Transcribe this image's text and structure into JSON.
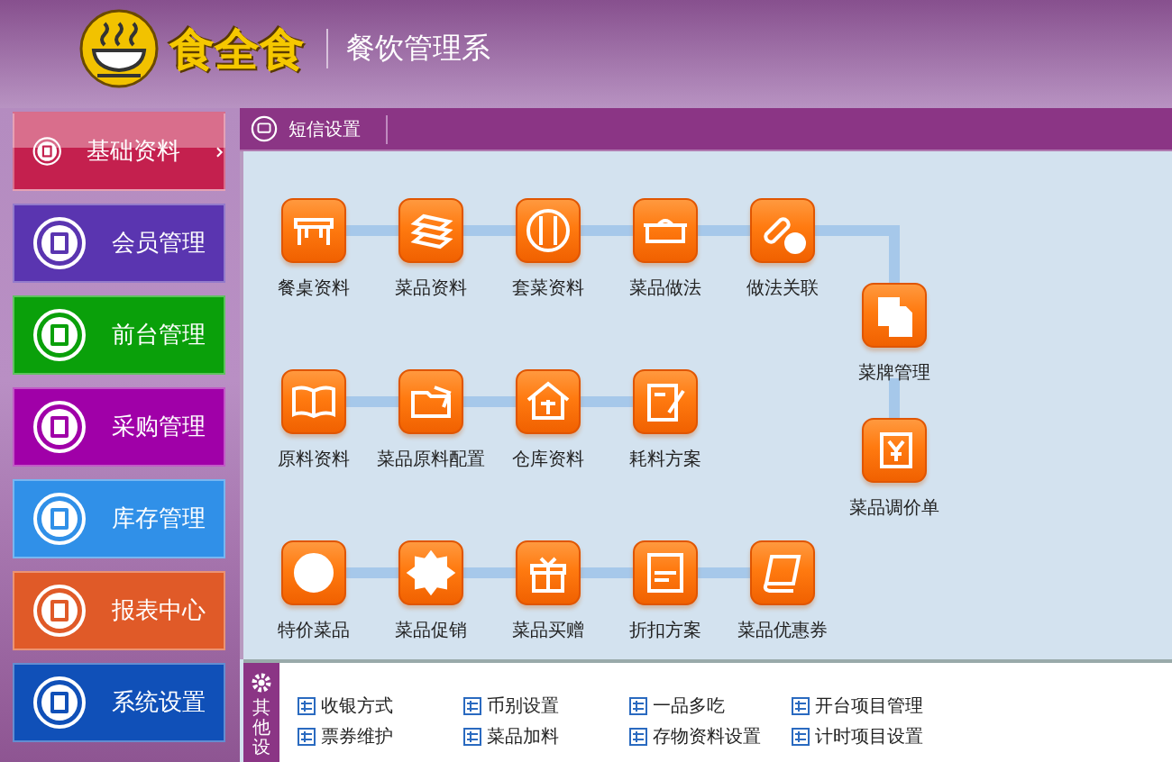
{
  "header": {
    "brand": "食全食",
    "system_title": "餐饮管理系"
  },
  "sidebar": {
    "items": [
      {
        "label": "基础资料",
        "selected": true,
        "color": "#c4204e"
      },
      {
        "label": "会员管理",
        "selected": false,
        "color": "#5a35b0"
      },
      {
        "label": "前台管理",
        "selected": false,
        "color": "#0aa00a"
      },
      {
        "label": "采购管理",
        "selected": false,
        "color": "#a000a8"
      },
      {
        "label": "库存管理",
        "selected": false,
        "color": "#3090e8"
      },
      {
        "label": "报表中心",
        "selected": false,
        "color": "#e05a28"
      },
      {
        "label": "系统设置",
        "selected": false,
        "color": "#1050b8"
      }
    ]
  },
  "tab": {
    "label": "短信设置"
  },
  "modules": [
    {
      "label": "餐桌资料"
    },
    {
      "label": "菜品资料"
    },
    {
      "label": "套菜资料"
    },
    {
      "label": "菜品做法"
    },
    {
      "label": "做法关联"
    },
    {
      "label": "菜牌管理"
    },
    {
      "label": "菜品调价单"
    },
    {
      "label": "原料资料"
    },
    {
      "label": "菜品原料配置"
    },
    {
      "label": "仓库资料"
    },
    {
      "label": "耗料方案"
    },
    {
      "label": "特价菜品"
    },
    {
      "label": "菜品促销"
    },
    {
      "label": "菜品买赠"
    },
    {
      "label": "折扣方案"
    },
    {
      "label": "菜品优惠券"
    }
  ],
  "other_settings": {
    "title": "其他设",
    "links": [
      {
        "label": "收银方式"
      },
      {
        "label": "币别设置"
      },
      {
        "label": "一品多吃"
      },
      {
        "label": "开台项目管理"
      },
      {
        "label": "票券维护"
      },
      {
        "label": "菜品加料"
      },
      {
        "label": "存物资料设置"
      },
      {
        "label": "计时项目设置"
      }
    ]
  }
}
